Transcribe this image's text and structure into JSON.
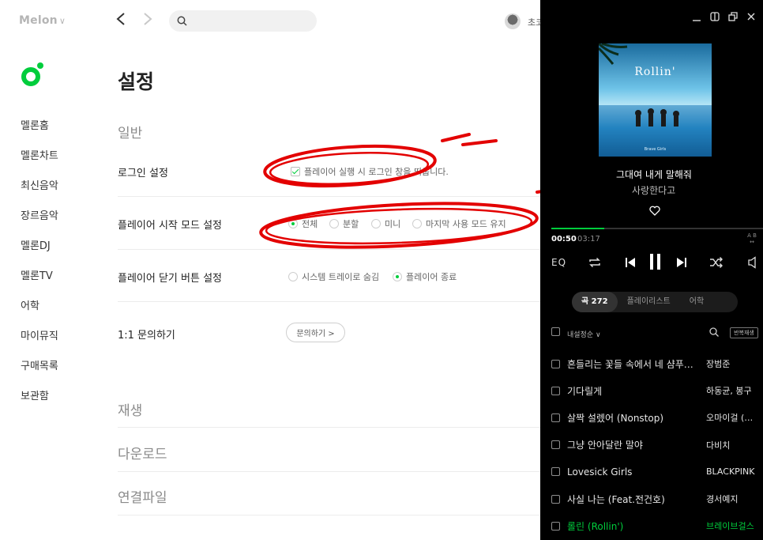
{
  "app": {
    "logo_text": "Melon",
    "brand_color": "#00cd3c",
    "user_name": "초코"
  },
  "toolbar": {
    "back_label": "<",
    "forward_label": ">",
    "search_placeholder": ""
  },
  "sidebar": {
    "items": [
      {
        "label": "멜론홈"
      },
      {
        "label": "멜론차트"
      },
      {
        "label": "최신음악"
      },
      {
        "label": "장르음악"
      },
      {
        "label": "멜론DJ"
      },
      {
        "label": "멜론TV"
      },
      {
        "label": "어학"
      },
      {
        "label": "마이뮤직"
      },
      {
        "label": "구매목록"
      },
      {
        "label": "보관함"
      }
    ]
  },
  "settings": {
    "title": "설정",
    "general_heading": "일반",
    "login": {
      "label": "로그인 설정",
      "option": "플레이어 실행 시 로그인 창을 띄웁니다.",
      "checked": true
    },
    "start_mode": {
      "label": "플레이어 시작 모드 설정",
      "options": [
        "전체",
        "분할",
        "미니",
        "마지막 사용 모드 유지"
      ],
      "selected": "전체"
    },
    "close_button": {
      "label": "플레이어 닫기 버튼 설정",
      "options": [
        "시스템 트레이로 숨김",
        "플레이어 종료"
      ],
      "selected": "플레이어 종료"
    },
    "inquiry": {
      "label": "1:1 문의하기",
      "button": "문의하기 >"
    },
    "playback_heading": "재생",
    "download_heading": "다운로드",
    "filetype_heading": "연결파일"
  },
  "player": {
    "album_title": "Rollin'",
    "album_artist_small": "Brave Girls",
    "song_title": "그대여 내게 말해줘",
    "song_subtitle": "사랑한다고",
    "time_current": "00:50",
    "time_total": "03:17",
    "progress": 0.25,
    "ab_label": "A B",
    "eq_label": "EQ",
    "tabs": [
      "곡 272",
      "플레이리스트",
      "어학"
    ],
    "active_tab": "곡 272",
    "sort_label": "내설정순",
    "repeat_button": "반복재생",
    "tracks": [
      {
        "title": "흔들리는 꽃들 속에서 네 샴푸향이 느껴진거야",
        "artist": "장범준"
      },
      {
        "title": "기다릴게",
        "artist": "하동균, 봉구"
      },
      {
        "title": "살짝 설렜어 (Nonstop)",
        "artist": "오마이걸 (OH MY GIRL)"
      },
      {
        "title": "그냥 안아달란 말야",
        "artist": "다비치"
      },
      {
        "title": "Lovesick Girls",
        "artist": "BLACKPINK"
      },
      {
        "title": "사실 나는 (Feat.전건호)",
        "artist": "경서예지"
      },
      {
        "title": "롤린 (Rollin')",
        "artist": "브레이브걸스",
        "current": true
      }
    ]
  }
}
